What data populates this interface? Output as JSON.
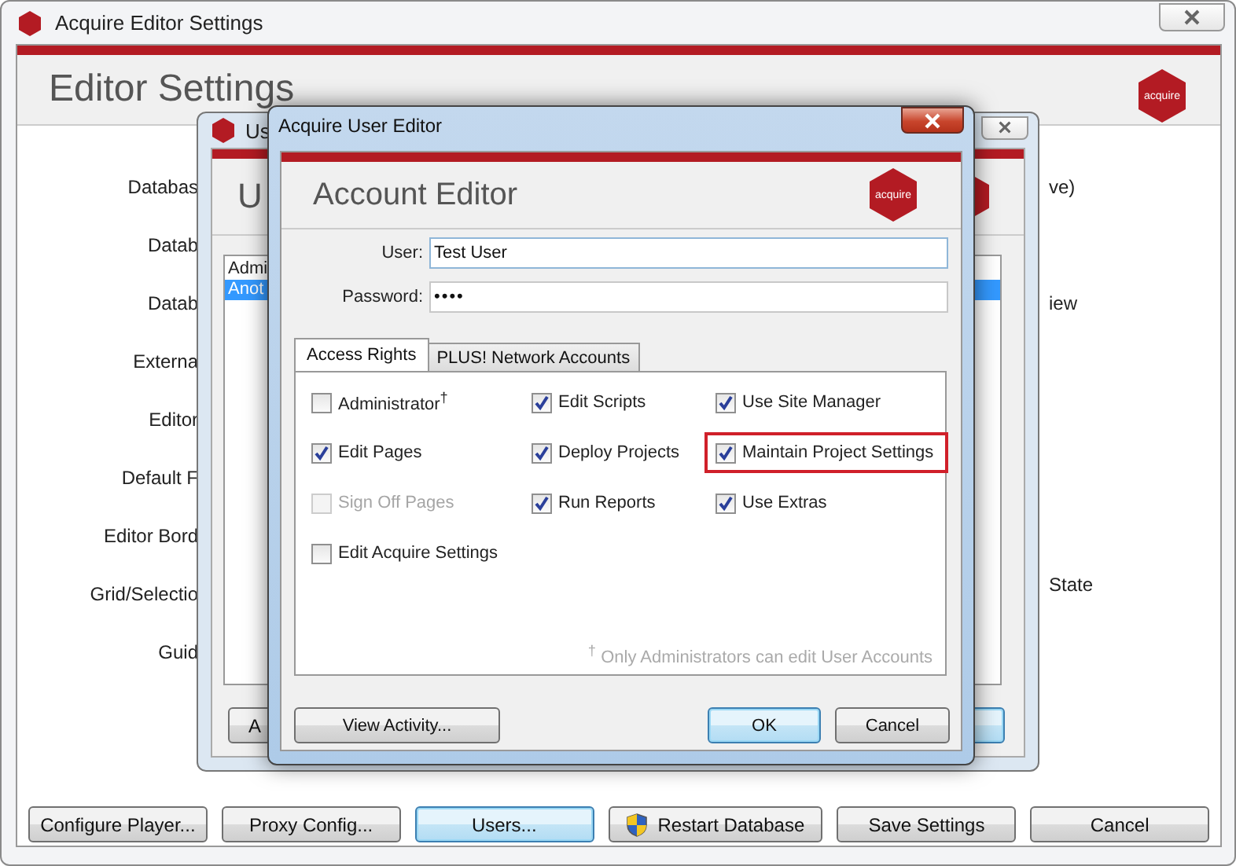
{
  "window": {
    "title": "Acquire Editor Settings"
  },
  "header": {
    "title": "Editor Settings",
    "logo_text": "acquire"
  },
  "settings_rows": [
    {
      "left": "Databas",
      "right": "ve)"
    },
    {
      "left": "Datab"
    },
    {
      "left": "Datab",
      "right": "iew"
    },
    {
      "left": "Externa"
    },
    {
      "left": "Editor"
    },
    {
      "left": "Default F"
    },
    {
      "left": "Editor Bord"
    },
    {
      "left": "Grid/Selectio",
      "right": "State"
    },
    {
      "left": "Guid"
    }
  ],
  "buttons": [
    {
      "label": "Configure Player...",
      "default": false
    },
    {
      "label": "Proxy Config...",
      "default": false
    },
    {
      "label": "Users...",
      "default": true
    },
    {
      "label": "Restart Database",
      "default": false,
      "kind": "admin"
    },
    {
      "label": "Save Settings",
      "default": false
    },
    {
      "label": "Cancel",
      "default": false
    }
  ],
  "user_window": {
    "title": "Us",
    "header": "U",
    "users": [
      {
        "name": "Admi",
        "selected": false
      },
      {
        "name": "Anot",
        "selected": true
      }
    ],
    "button": "A"
  },
  "dialog": {
    "title": "Acquire User Editor",
    "header": "Account Editor",
    "logo_text": "acquire",
    "fields": [
      {
        "label": "User:",
        "value": "Test User"
      },
      {
        "label": "Password:",
        "value": "••••"
      }
    ],
    "tabs": [
      {
        "label": "Access Rights",
        "selected": true
      },
      {
        "label": "PLUS! Network Accounts",
        "selected": false
      }
    ],
    "permissions": [
      {
        "label": "Administrator$^{†}$",
        "checked": false,
        "disabled": false,
        "highlighted": false
      },
      {
        "label": "Edit Scripts",
        "checked": true,
        "disabled": false,
        "highlighted": false
      },
      {
        "label": "Use Site Manager",
        "checked": true,
        "disabled": false,
        "highlighted": false
      },
      {
        "label": "Edit Pages",
        "checked": true,
        "disabled": false,
        "highlighted": false
      },
      {
        "label": "Deploy Projects",
        "checked": true,
        "disabled": false,
        "highlighted": false
      },
      {
        "label": "Maintain Project Settings",
        "checked": true,
        "disabled": false,
        "highlighted": true
      },
      {
        "label": "Sign Off Pages",
        "checked": false,
        "disabled": true,
        "highlighted": false
      },
      {
        "label": "Run Reports",
        "checked": true,
        "disabled": false,
        "highlighted": false
      },
      {
        "label": "Use Extras",
        "checked": true,
        "disabled": false,
        "highlighted": false
      },
      {
        "label": "Edit Acquire Settings",
        "checked": false,
        "disabled": false,
        "highlighted": false
      }
    ],
    "footnote": "$^{†}$ Only Administrators can edit User Accounts",
    "buttons": [
      {
        "label": "View Activity...",
        "default": false
      },
      {
        "label": "OK",
        "default": true
      },
      {
        "label": "Cancel",
        "default": false
      }
    ]
  }
}
